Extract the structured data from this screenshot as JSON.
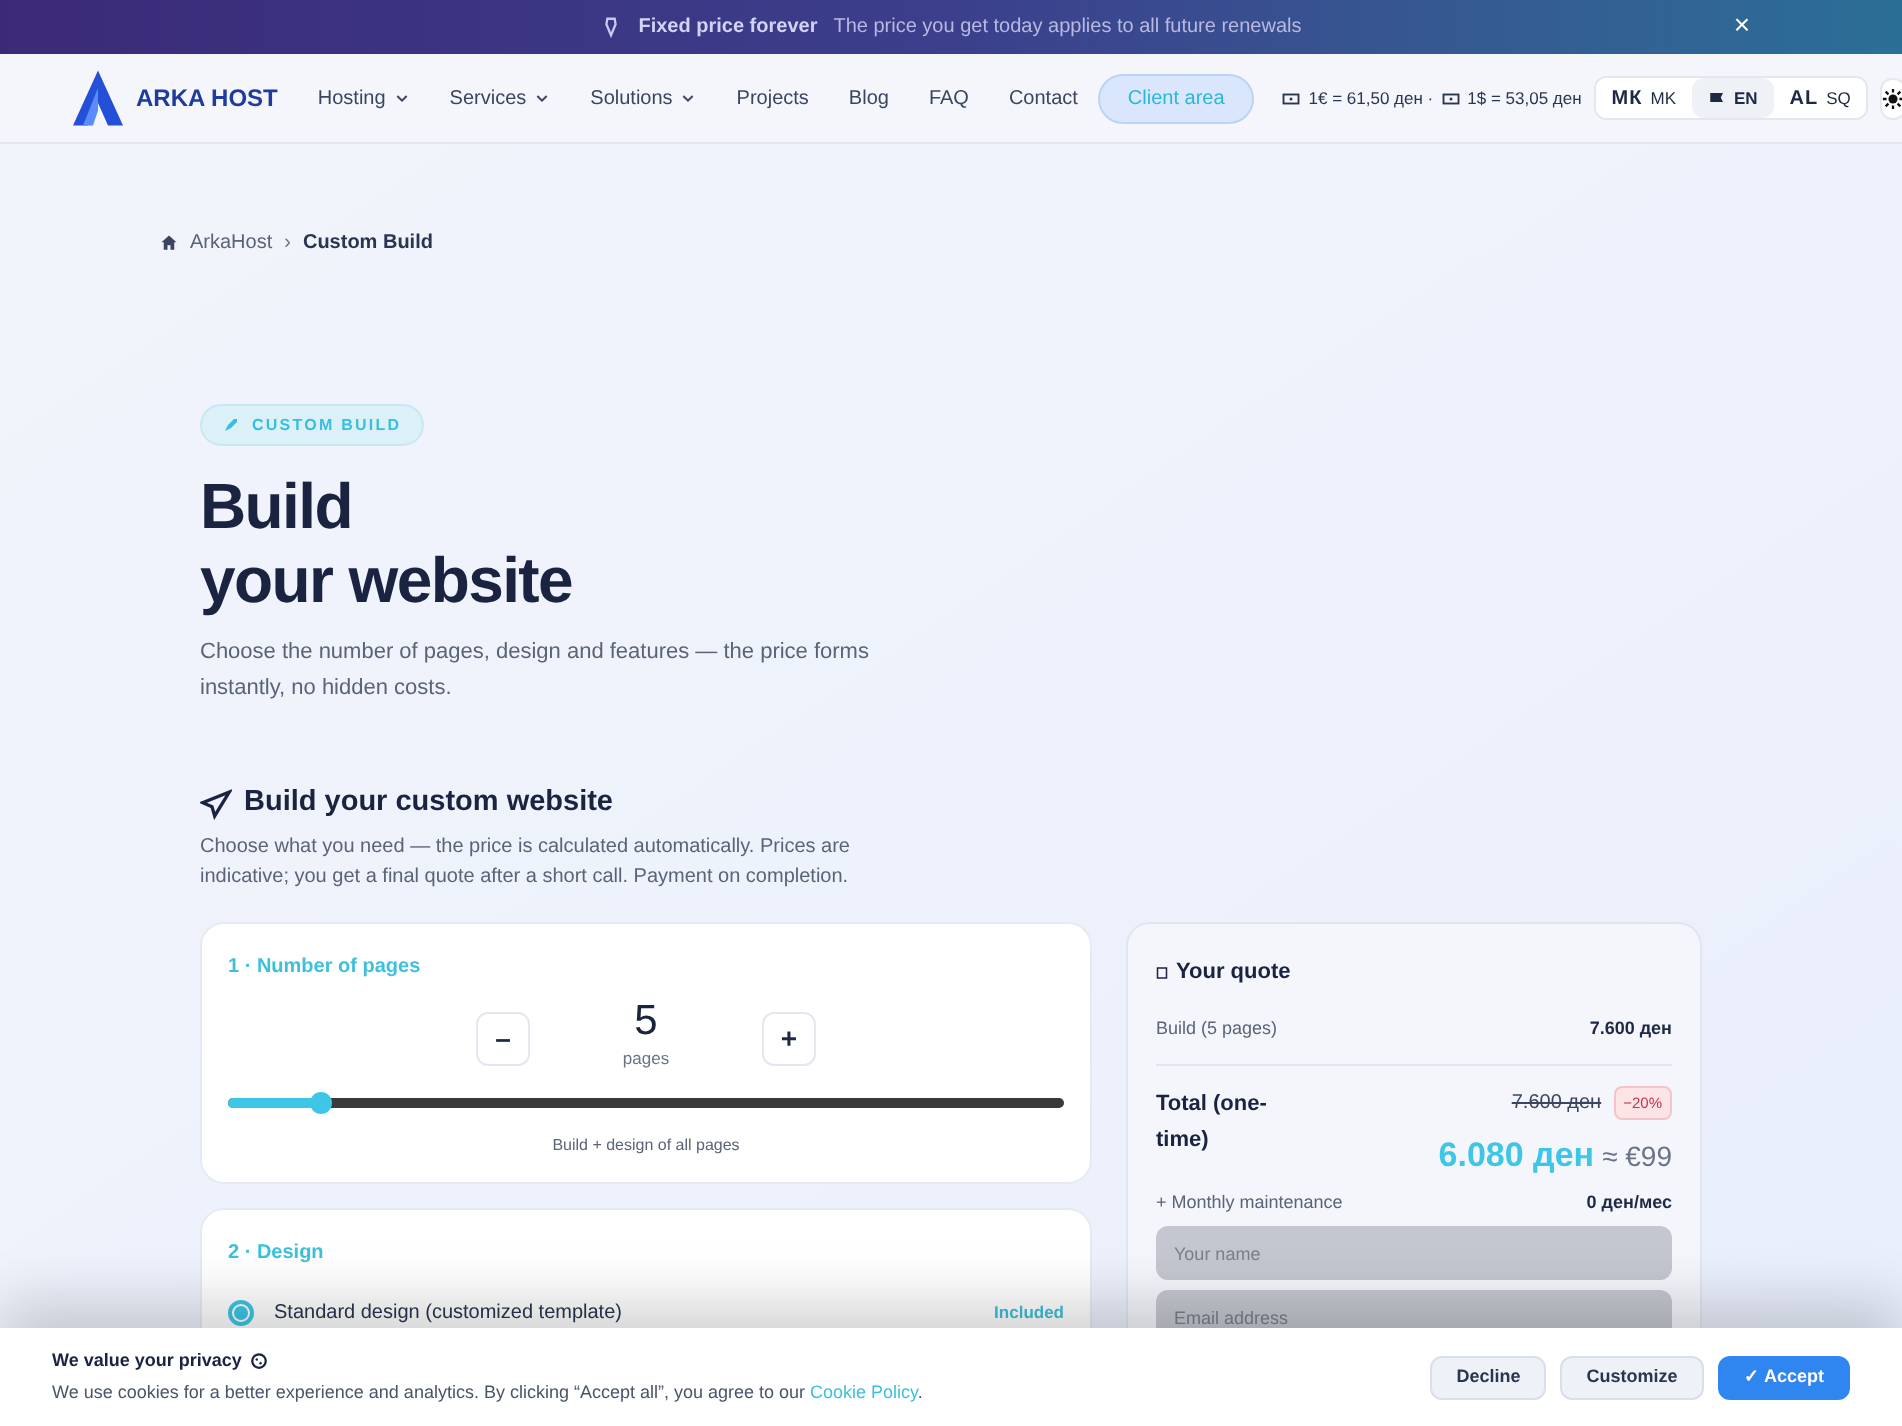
{
  "banner": {
    "title": "Fixed price forever",
    "text": "The price you get today applies to all future renewals",
    "close": "×"
  },
  "nav": {
    "logo": "ARKA HOST",
    "menu": [
      {
        "label": "Hosting",
        "dropdown": true
      },
      {
        "label": "Services",
        "dropdown": true
      },
      {
        "label": "Solutions",
        "dropdown": true
      },
      {
        "label": "Projects",
        "dropdown": false
      },
      {
        "label": "Blog",
        "dropdown": false
      },
      {
        "label": "FAQ",
        "dropdown": false
      },
      {
        "label": "Contact",
        "dropdown": false
      }
    ],
    "client_area": "Client area",
    "rates": [
      {
        "text": "1€ = 61,50 ден ·"
      },
      {
        "text": "1$ = 53,05 ден"
      }
    ],
    "languages": [
      {
        "mark": "МК",
        "code": "MK",
        "selected": false,
        "kind": "text"
      },
      {
        "code": "EN",
        "selected": true,
        "kind": "flag"
      },
      {
        "mark": "AL",
        "code": "SQ",
        "selected": false,
        "kind": "text"
      }
    ]
  },
  "breadcrumb": {
    "separator": "›",
    "items": [
      {
        "label": "ArkaHost"
      },
      {
        "label": "Custom Build"
      }
    ]
  },
  "hero": {
    "badge": "CUSTOM BUILD",
    "title_lines": [
      "Build",
      "your website"
    ],
    "text": "Choose the number of pages, design and features — the price forms instantly, no hidden costs."
  },
  "builder": {
    "title": "Build your custom website",
    "text": "Choose what you need — the price is calculated automatically. Prices are indicative; you get a final quote after a short call. Payment on completion.",
    "pages": {
      "heading": "1 · Number of pages",
      "minus": "–",
      "plus": "+",
      "count": "5",
      "unit": "pages",
      "level": 0.11,
      "note": "Build + design of all pages"
    },
    "design": {
      "heading": "2 · Design",
      "options": [
        {
          "label": "Standard design (customized template)",
          "price": "Included",
          "selected": true
        }
      ]
    }
  },
  "quote": {
    "title": "Your quote",
    "lines": [
      {
        "label": "Build (5 pages)",
        "value": "7.600 ден"
      }
    ],
    "total_label": "Total (one-time)",
    "old_price": "7.600 ден",
    "discount": "−20%",
    "price": "6.080 ден",
    "approx": "≈ €99",
    "monthly_label": "+ Monthly maintenance",
    "monthly_value": "0 ден/мес",
    "fields": [
      {
        "placeholder": "Your name"
      },
      {
        "placeholder": "Email address"
      }
    ]
  },
  "cookie": {
    "title": "We value your privacy",
    "text": "We use cookies for a better experience and analytics. By clicking “Accept all”, you agree to our ",
    "link": "Cookie Policy",
    "end": ".",
    "buttons": [
      {
        "label": "Decline",
        "kind": "secondary"
      },
      {
        "label": "Customize",
        "kind": "secondary"
      },
      {
        "label": "✓ Accept",
        "kind": "primary"
      }
    ]
  }
}
